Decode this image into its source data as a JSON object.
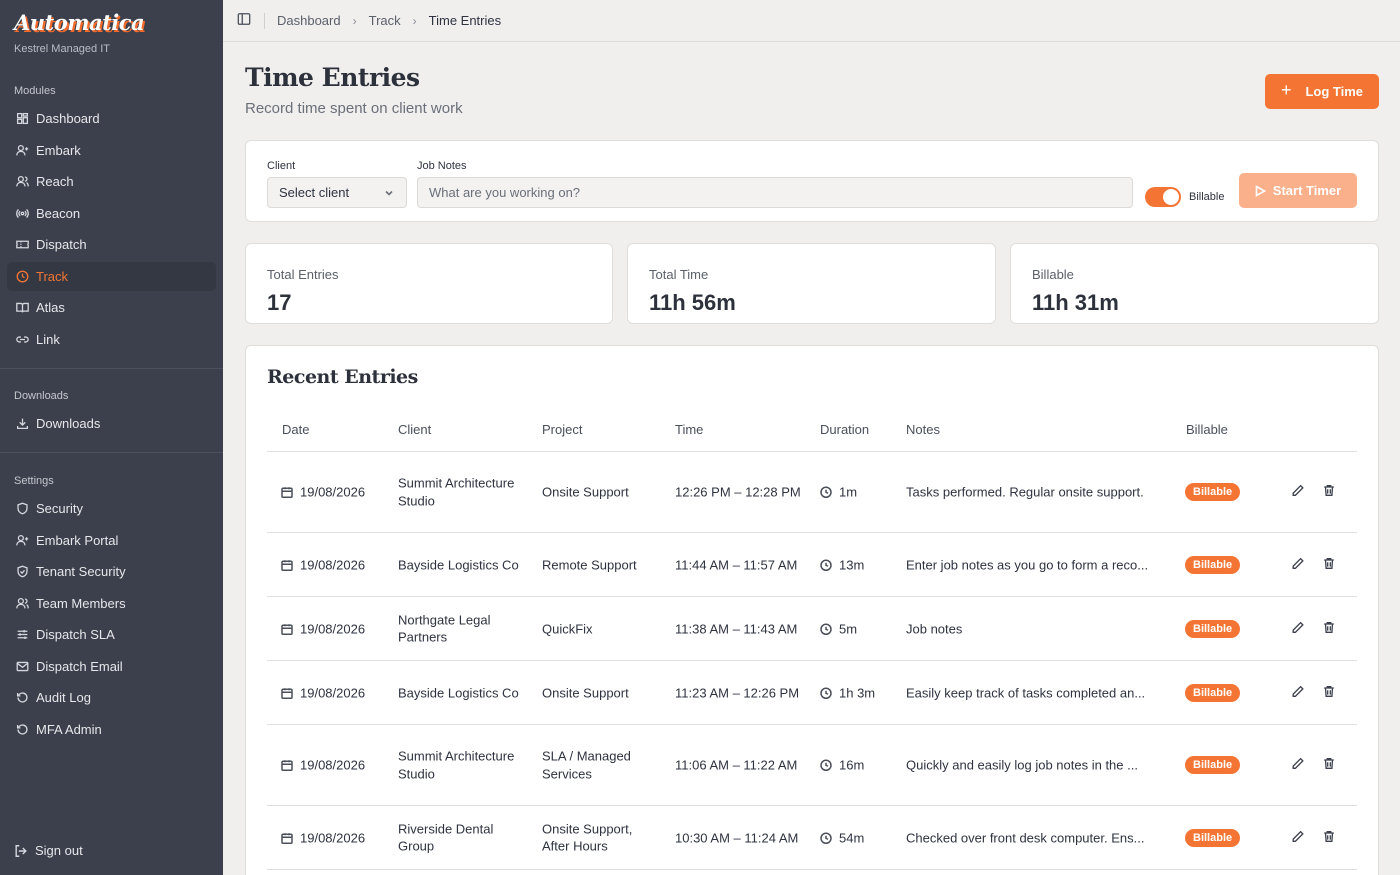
{
  "brand": {
    "logo": "Automatica",
    "org": "Kestrel Managed IT"
  },
  "sidebar": {
    "modules_label": "Modules",
    "modules": [
      {
        "label": "Dashboard",
        "icon": "grid-icon"
      },
      {
        "label": "Embark",
        "icon": "user-plus-icon"
      },
      {
        "label": "Reach",
        "icon": "users-icon"
      },
      {
        "label": "Beacon",
        "icon": "broadcast-icon"
      },
      {
        "label": "Dispatch",
        "icon": "ticket-icon"
      },
      {
        "label": "Track",
        "icon": "clock-icon",
        "active": true
      },
      {
        "label": "Atlas",
        "icon": "book-icon"
      },
      {
        "label": "Link",
        "icon": "link-icon"
      }
    ],
    "downloads_label": "Downloads",
    "downloads": [
      {
        "label": "Downloads",
        "icon": "download-icon"
      }
    ],
    "settings_label": "Settings",
    "settings": [
      {
        "label": "Security",
        "icon": "shield-icon"
      },
      {
        "label": "Embark Portal",
        "icon": "user-plus-icon"
      },
      {
        "label": "Tenant Security",
        "icon": "shield-check-icon"
      },
      {
        "label": "Team Members",
        "icon": "users-icon"
      },
      {
        "label": "Dispatch SLA",
        "icon": "sliders-icon"
      },
      {
        "label": "Dispatch Email",
        "icon": "mail-icon"
      },
      {
        "label": "Audit Log",
        "icon": "history-icon"
      },
      {
        "label": "MFA Admin",
        "icon": "history-icon"
      }
    ],
    "signout": "Sign out"
  },
  "breadcrumb": [
    "Dashboard",
    "Track",
    "Time Entries"
  ],
  "header": {
    "title": "Time Entries",
    "subtitle": "Record time spent on client work",
    "log_button": "Log Time"
  },
  "timer": {
    "client_label": "Client",
    "client_value": "Select client",
    "notes_label": "Job Notes",
    "notes_placeholder": "What are you working on?",
    "billable_label": "Billable",
    "billable_on": true,
    "start_button": "Start Timer"
  },
  "stats": [
    {
      "label": "Total Entries",
      "value": "17"
    },
    {
      "label": "Total Time",
      "value": "11h 56m"
    },
    {
      "label": "Billable",
      "value": "11h 31m"
    }
  ],
  "entries": {
    "title": "Recent Entries",
    "columns": [
      "Date",
      "Client",
      "Project",
      "Time",
      "Duration",
      "Notes",
      "Billable"
    ],
    "rows": [
      {
        "date": "19/08/2026",
        "client": "Summit Architecture Studio",
        "project": "Onsite Support",
        "time": "12:26 PM – 12:28 PM",
        "duration": "1m",
        "notes": "Tasks performed. Regular onsite support.",
        "billable": "Billable"
      },
      {
        "date": "19/08/2026",
        "client": "Bayside Logistics Co",
        "project": "Remote Support",
        "time": "11:44 AM – 11:57 AM",
        "duration": "13m",
        "notes": "Enter job notes as you go to form a reco...",
        "billable": "Billable"
      },
      {
        "date": "19/08/2026",
        "client": "Northgate Legal Partners",
        "project": "QuickFix",
        "time": "11:38 AM – 11:43 AM",
        "duration": "5m",
        "notes": "Job notes",
        "billable": "Billable"
      },
      {
        "date": "19/08/2026",
        "client": "Bayside Logistics Co",
        "project": "Onsite Support",
        "time": "11:23 AM – 12:26 PM",
        "duration": "1h 3m",
        "notes": "Easily keep track of tasks completed an...",
        "billable": "Billable"
      },
      {
        "date": "19/08/2026",
        "client": "Summit Architecture Studio",
        "project": "SLA / Managed Services",
        "time": "11:06 AM – 11:22 AM",
        "duration": "16m",
        "notes": "Quickly and easily log job notes in the ...",
        "billable": "Billable"
      },
      {
        "date": "19/08/2026",
        "client": "Riverside Dental Group",
        "project": "Onsite Support, After Hours",
        "time": "10:30 AM – 11:24 AM",
        "duration": "54m",
        "notes": "Checked over front desk computer. Ens...",
        "billable": "Billable"
      }
    ]
  },
  "colors": {
    "accent": "#f47533",
    "sidebar": "#3c404c",
    "background": "#f0efed"
  }
}
